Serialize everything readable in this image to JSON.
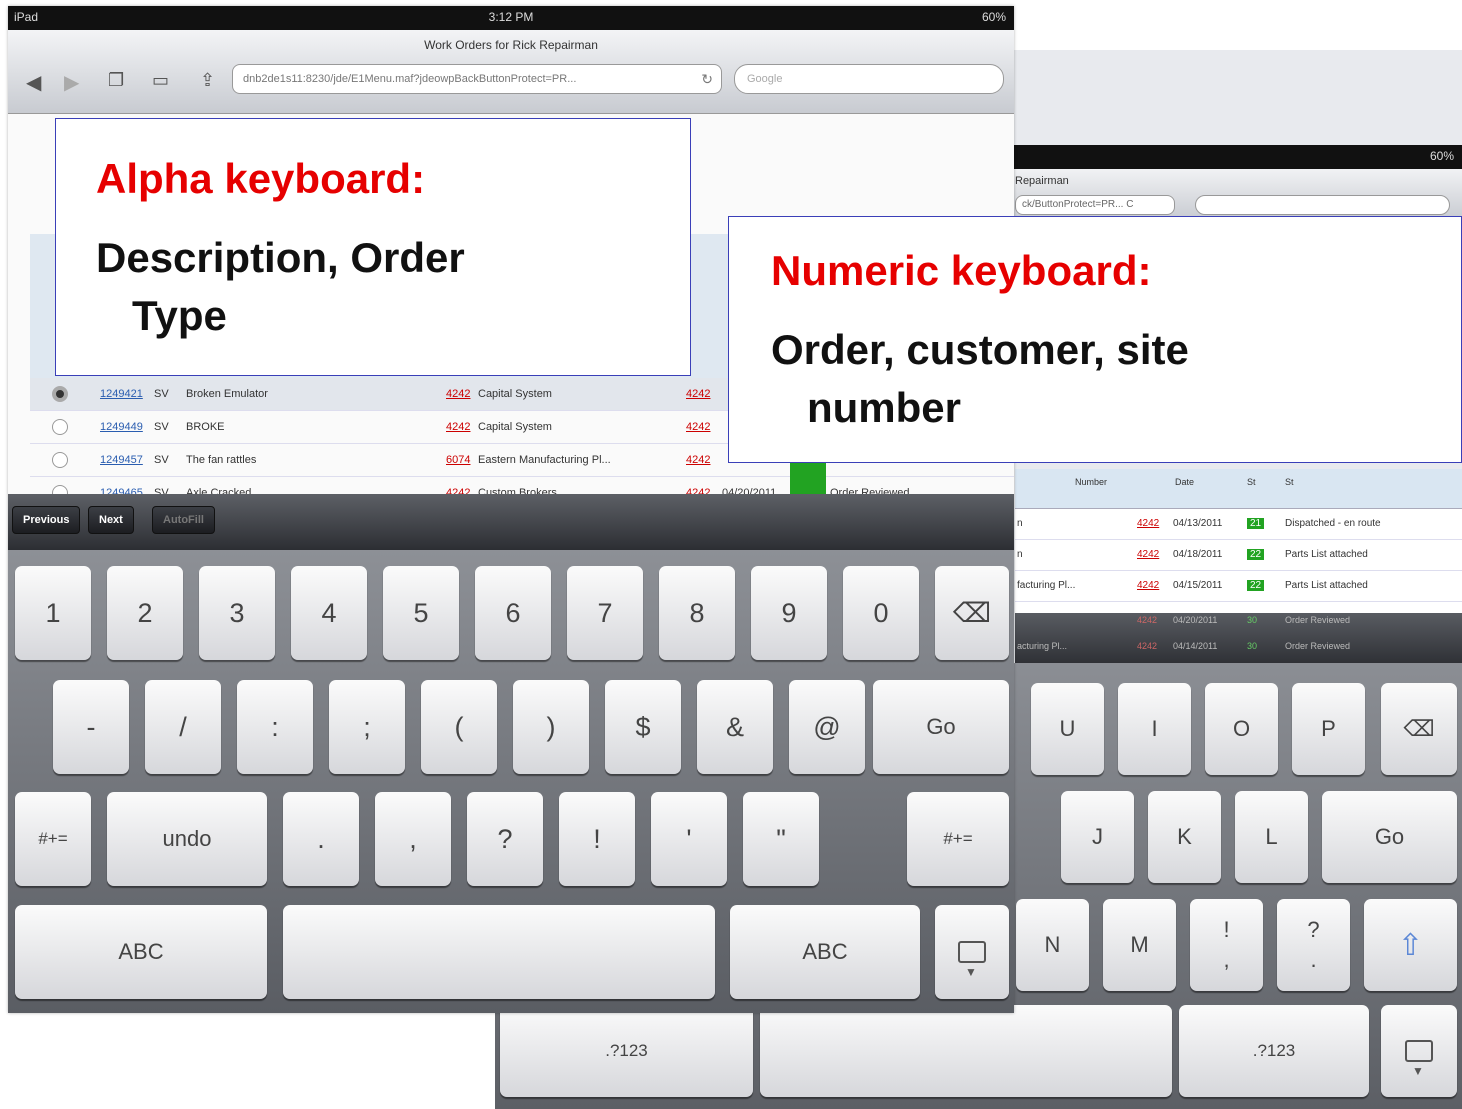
{
  "back_screen": {
    "battery": "60%",
    "title_fragment": "Repairman",
    "url_fragment": "ck/ButtonProtect=PR... C",
    "table_headers": [
      "Number",
      "Date",
      "St",
      "St"
    ],
    "rows": [
      {
        "pre": "n",
        "site": "4242",
        "date": "04/13/2011",
        "st": "21",
        "status": "Dispatched - en route"
      },
      {
        "pre": "n",
        "site": "4242",
        "date": "04/18/2011",
        "st": "22",
        "status": "Parts List attached"
      },
      {
        "pre": "facturing Pl...",
        "site": "4242",
        "date": "04/15/2011",
        "st": "22",
        "status": "Parts List attached"
      },
      {
        "pre": "",
        "site": "4242",
        "date": "04/20/2011",
        "st": "30",
        "status": "Order Reviewed"
      },
      {
        "pre": "acturing Pl...",
        "site": "4242",
        "date": "04/14/2011",
        "st": "30",
        "status": "Order Reviewed"
      }
    ],
    "keyboard": {
      "row1": [
        "U",
        "I",
        "O",
        "P"
      ],
      "row2": [
        "J",
        "K",
        "L",
        "Go"
      ],
      "row3": [
        "N",
        "M",
        "!",
        "?"
      ],
      "row3_sub": [
        ",",
        "."
      ],
      "row4": [
        ".?123",
        ".?123"
      ]
    }
  },
  "front_screen": {
    "status_left": "iPad",
    "time": "3:12 PM",
    "battery": "60%",
    "title": "Work Orders for Rick Repairman",
    "url": "dnb2de1s11:8230/jde/E1Menu.maf?jdeowpBackButtonProtect=PR...",
    "search_placeholder": "Google",
    "rows": [
      {
        "order": "1249421",
        "type": "SV",
        "desc": "Broken Emulator",
        "cust": "4242",
        "cust_name": "Capital System",
        "site": "4242",
        "selected": true
      },
      {
        "order": "1249449",
        "type": "SV",
        "desc": "BROKE",
        "cust": "4242",
        "cust_name": "Capital System",
        "site": "4242",
        "selected": false
      },
      {
        "order": "1249457",
        "type": "SV",
        "desc": "The fan rattles",
        "cust": "6074",
        "cust_name": "Eastern Manufacturing Pl...",
        "site": "4242",
        "selected": false
      },
      {
        "order": "1249465",
        "type": "SV",
        "desc": "Axle Cracked",
        "cust": "4242",
        "cust_name": "Custom Brokers",
        "site": "4242",
        "date": "04/20/2011",
        "status": "Order Reviewed",
        "selected": false
      }
    ],
    "accessory": {
      "previous": "Previous",
      "next": "Next",
      "autofill": "AutoFill"
    },
    "keyboard": {
      "row1": [
        "1",
        "2",
        "3",
        "4",
        "5",
        "6",
        "7",
        "8",
        "9",
        "0"
      ],
      "row2": [
        "-",
        "/",
        ":",
        ";",
        "(",
        ")",
        "$",
        "&",
        "@",
        "Go"
      ],
      "row3": [
        "#+=",
        "undo",
        ".",
        ",",
        "?",
        "!",
        "'",
        "\"",
        "#+="
      ],
      "row4": [
        "ABC",
        "ABC"
      ]
    }
  },
  "callouts": {
    "alpha": {
      "title": "Alpha keyboard:",
      "line1": "Description, Order",
      "line2": "Type"
    },
    "numeric": {
      "title": "Numeric keyboard:",
      "line1": "Order, customer, site",
      "line2": "number"
    }
  }
}
